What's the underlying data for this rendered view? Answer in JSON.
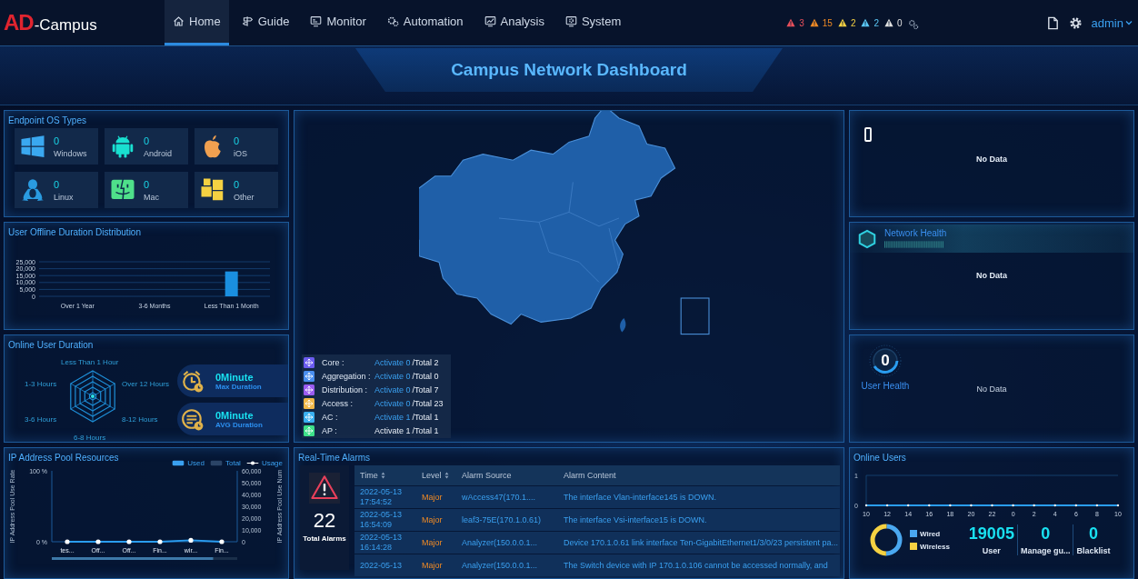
{
  "header": {
    "logo": {
      "mark": "AD",
      "text": "-Campus"
    },
    "nav": [
      {
        "label": "Home",
        "selected": true
      },
      {
        "label": "Guide",
        "selected": false
      },
      {
        "label": "Monitor",
        "selected": false
      },
      {
        "label": "Automation",
        "selected": false
      },
      {
        "label": "Analysis",
        "selected": false
      },
      {
        "label": "System",
        "selected": false
      }
    ],
    "alarm_counts": [
      {
        "count": "3",
        "color": "#e8505b"
      },
      {
        "count": "15",
        "color": "#f08a24"
      },
      {
        "count": "2",
        "color": "#f5d142"
      },
      {
        "count": "2",
        "color": "#5bc8f5"
      },
      {
        "count": "0",
        "color": "#e0e0e0"
      }
    ],
    "user": "admin"
  },
  "title": "Campus Network Dashboard",
  "endpoint_os": {
    "title": "Endpoint OS Types",
    "items": [
      {
        "kind": "windows",
        "count": "0",
        "label": "Windows"
      },
      {
        "kind": "android",
        "count": "0",
        "label": "Android"
      },
      {
        "kind": "ios",
        "count": "0",
        "label": "iOS"
      },
      {
        "kind": "linux",
        "count": "0",
        "label": "Linux"
      },
      {
        "kind": "mac",
        "count": "0",
        "label": "Mac"
      },
      {
        "kind": "other",
        "count": "0",
        "label": "Other"
      }
    ]
  },
  "offline_duration": {
    "title": "User Offline Duration Distribution",
    "chart_data": {
      "type": "bar",
      "categories": [
        "Over 1 Year",
        "3-6 Months",
        "Less Than 1 Month"
      ],
      "values": [
        0,
        0,
        18000
      ],
      "grid": true,
      "ylim": [
        0,
        25000
      ],
      "yticks": [
        {
          "value": 0,
          "label": "0"
        },
        {
          "value": 5000,
          "label": "5,000"
        },
        {
          "value": 10000,
          "label": "10,000"
        },
        {
          "value": 15000,
          "label": "15,000"
        },
        {
          "value": 20000,
          "label": "20,000"
        },
        {
          "value": 25000,
          "label": "25,000"
        }
      ]
    }
  },
  "online_duration": {
    "title": "Online User Duration",
    "radar_axes": [
      "Less Than 1 Hour",
      "Over 12 Hours",
      "8-12 Hours",
      "6-8 Hours",
      "3-6 Hours",
      "1-3 Hours"
    ],
    "stats": [
      {
        "kind": "max",
        "value": "0Minute",
        "label": "Max Duration"
      },
      {
        "kind": "avg",
        "value": "0Minute",
        "label": "AVG Duration"
      }
    ]
  },
  "ip_pool": {
    "title": "IP Address Pool Resources",
    "legend": [
      {
        "label": "Used",
        "kind": "bar",
        "color": "#3aa0f0"
      },
      {
        "label": "Total",
        "kind": "bar",
        "color": "#2b4466"
      }
    ],
    "right_axis": {
      "label": "IP Address Pool Use Num",
      "ticks": [
        "60,000",
        "50,000",
        "40,000",
        "30,000",
        "20,000",
        "10,000",
        "0"
      ]
    },
    "chart_data": {
      "type": "line",
      "ylabel": "IP Address Pool Use Rate",
      "categories": [
        "tes...",
        "Off...",
        "Off...",
        "Fin...",
        "wir...",
        "Fin..."
      ],
      "series": [
        {
          "name": "Usage",
          "color": "#2a9df0",
          "values": [
            0,
            0,
            0,
            0,
            2,
            0
          ]
        }
      ],
      "ylim": [
        0,
        100
      ],
      "yticks": [
        {
          "value": 0,
          "label": "0 %"
        },
        {
          "value": 100,
          "label": "100 %"
        }
      ]
    }
  },
  "network_map": {
    "devices": [
      {
        "label": "Core :",
        "active": "Activate 0",
        "total": "/Total 2",
        "highlight": true,
        "color": "#6b5cf0"
      },
      {
        "label": "Aggregation :",
        "active": "Activate 0",
        "total": "/Total 0",
        "highlight": true,
        "color": "#4a8ff0"
      },
      {
        "label": "Distribution :",
        "active": "Activate 0",
        "total": "/Total 7",
        "highlight": true,
        "color": "#9b5cf0"
      },
      {
        "label": "Access :",
        "active": "Activate 0",
        "total": "/Total 23",
        "highlight": true,
        "color": "#f0b84a"
      },
      {
        "label": "AC :",
        "active": "Activate 1",
        "total": "/Total 1",
        "highlight": true,
        "color": "#3ab0f0"
      },
      {
        "label": "AP :",
        "active": "Activate 1",
        "total": "/Total 1",
        "highlight": false,
        "color": "#3ee08a"
      }
    ]
  },
  "alarms": {
    "title": "Real-Time Alarms",
    "total": "22",
    "total_label": "Total Alarms",
    "columns": [
      {
        "label": "Time",
        "sortable": true
      },
      {
        "label": "Level",
        "sortable": true
      },
      {
        "label": "Alarm Source",
        "sortable": false
      },
      {
        "label": "Alarm Content",
        "sortable": false
      }
    ],
    "rows": [
      {
        "date": "2022-05-13",
        "time": "17:54:52",
        "level": "Major",
        "source": "wAccess47(170.1....",
        "content": "The interface Vlan-interface145 is DOWN."
      },
      {
        "date": "2022-05-13",
        "time": "16:54:09",
        "level": "Major",
        "source": "leaf3-75E(170.1.0.61)",
        "content": "The interface Vsi-interface15 is DOWN."
      },
      {
        "date": "2022-05-13",
        "time": "16:14:28",
        "level": "Major",
        "source": "Analyzer(150.0.0.1...",
        "content": "Device 170.1.0.61 link interface Ten-GigabitEthernet1/3/0/23 persistent pa..."
      },
      {
        "date": "2022-05-13",
        "time": "",
        "level": "Major",
        "source": "Analyzer(150.0.0.1...",
        "content": "The Switch device with IP 170.1.0.106 cannot be accessed normally, and"
      }
    ]
  },
  "overview": {
    "no_data": "No Data"
  },
  "network_health": {
    "title": "Network Health",
    "no_data": "No Data"
  },
  "user_health": {
    "score": "0",
    "title": "User Health",
    "no_data": "No Data"
  },
  "online_users": {
    "title": "Online Users",
    "chart_data": {
      "type": "line",
      "categories": [
        "10",
        "12",
        "14",
        "16",
        "18",
        "20",
        "22",
        "0",
        "2",
        "4",
        "6",
        "8",
        "10"
      ],
      "values": [
        0,
        0,
        0,
        0,
        0,
        0,
        0,
        0,
        0,
        0,
        0,
        0,
        0
      ],
      "ylim": [
        0,
        1
      ],
      "yticks": [
        0,
        1
      ]
    },
    "access_types": [
      {
        "label": "Wired",
        "color": "#4aa8f0"
      },
      {
        "label": "Wireless",
        "color": "#f5d142"
      }
    ],
    "stats": [
      {
        "value": "19005",
        "label": "User"
      },
      {
        "value": "0",
        "label": "Manage gu..."
      },
      {
        "value": "0",
        "label": "Blacklist"
      }
    ]
  }
}
